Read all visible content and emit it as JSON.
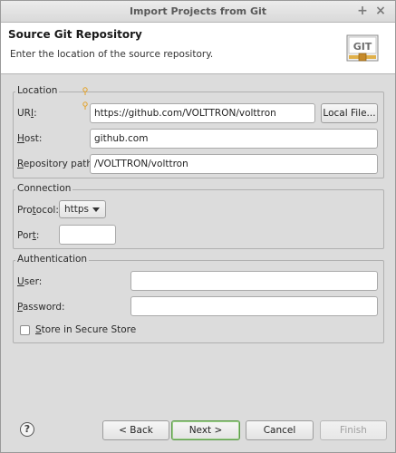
{
  "window": {
    "title": "Import Projects from Git",
    "pin_glyph": "+",
    "close_glyph": "×"
  },
  "header": {
    "title": "Source Git Repository",
    "description": "Enter the location of the source repository.",
    "logo_text": "GIT"
  },
  "location": {
    "legend": "Location",
    "uri_label_prefix": "UR",
    "uri_label_mnemonic": "I",
    "uri_label_suffix": ":",
    "uri_value": "https://github.com/VOLTTRON/volttron",
    "local_file_button": "Local File...",
    "host_label_mnemonic": "H",
    "host_label_suffix": "ost:",
    "host_value": "github.com",
    "repo_path_label_mnemonic": "R",
    "repo_path_label_suffix": "epository path:",
    "repo_path_value": "/VOLTTRON/volttron"
  },
  "connection": {
    "legend": "Connection",
    "protocol_label_prefix": "Pro",
    "protocol_label_mnemonic": "t",
    "protocol_label_suffix": "ocol:",
    "protocol_value": "https",
    "port_label_prefix": "Por",
    "port_label_mnemonic": "t",
    "port_label_suffix": ":",
    "port_value": ""
  },
  "authentication": {
    "legend": "Authentication",
    "user_label_mnemonic": "U",
    "user_label_suffix": "ser:",
    "user_value": "",
    "password_label_mnemonic": "P",
    "password_label_suffix": "assword:",
    "password_value": "",
    "store_label_mnemonic": "S",
    "store_label_suffix": "tore in Secure Store"
  },
  "footer": {
    "help_glyph": "?",
    "back_button": "< Back",
    "next_button": "Next >",
    "cancel_button": "Cancel",
    "finish_button": "Finish"
  },
  "colors": {
    "default_button_border": "#5c9a4a",
    "decoration_marker": "#e3a126"
  }
}
